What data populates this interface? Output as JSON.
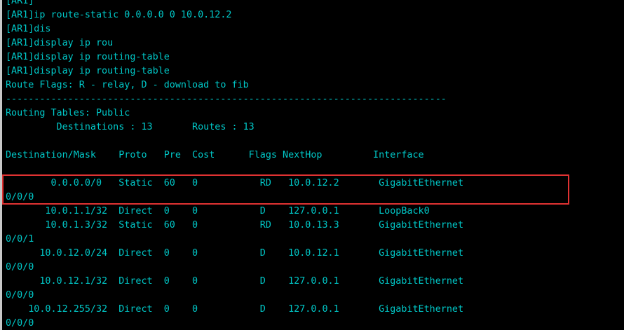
{
  "terminal": {
    "foreground_color": "#00c8c8",
    "background_color": "#000000",
    "highlight_color": "#e03232",
    "lines": [
      "[AR1]",
      "[AR1]ip route-static 0.0.0.0 0 10.0.12.2",
      "[AR1]dis",
      "[AR1]display ip rou",
      "[AR1]display ip routing-table",
      "[AR1]display ip routing-table",
      "Route Flags: R - relay, D - download to fib",
      "------------------------------------------------------------------------------",
      "Routing Tables: Public",
      "         Destinations : 13       Routes : 13",
      "",
      "Destination/Mask    Proto   Pre  Cost      Flags NextHop         Interface",
      "",
      "        0.0.0.0/0   Static  60   0           RD   10.0.12.2       GigabitEthernet",
      "0/0/0",
      "       10.0.1.1/32  Direct  0    0           D    127.0.0.1       LoopBack0",
      "       10.0.1.3/32  Static  60   0           RD   10.0.13.3       GigabitEthernet",
      "0/0/1",
      "      10.0.12.0/24  Direct  0    0           D    10.0.12.1       GigabitEthernet",
      "0/0/0",
      "      10.0.12.1/32  Direct  0    0           D    127.0.0.1       GigabitEthernet",
      "0/0/0",
      "    10.0.12.255/32  Direct  0    0           D    127.0.0.1       GigabitEthernet",
      "0/0/0"
    ]
  }
}
